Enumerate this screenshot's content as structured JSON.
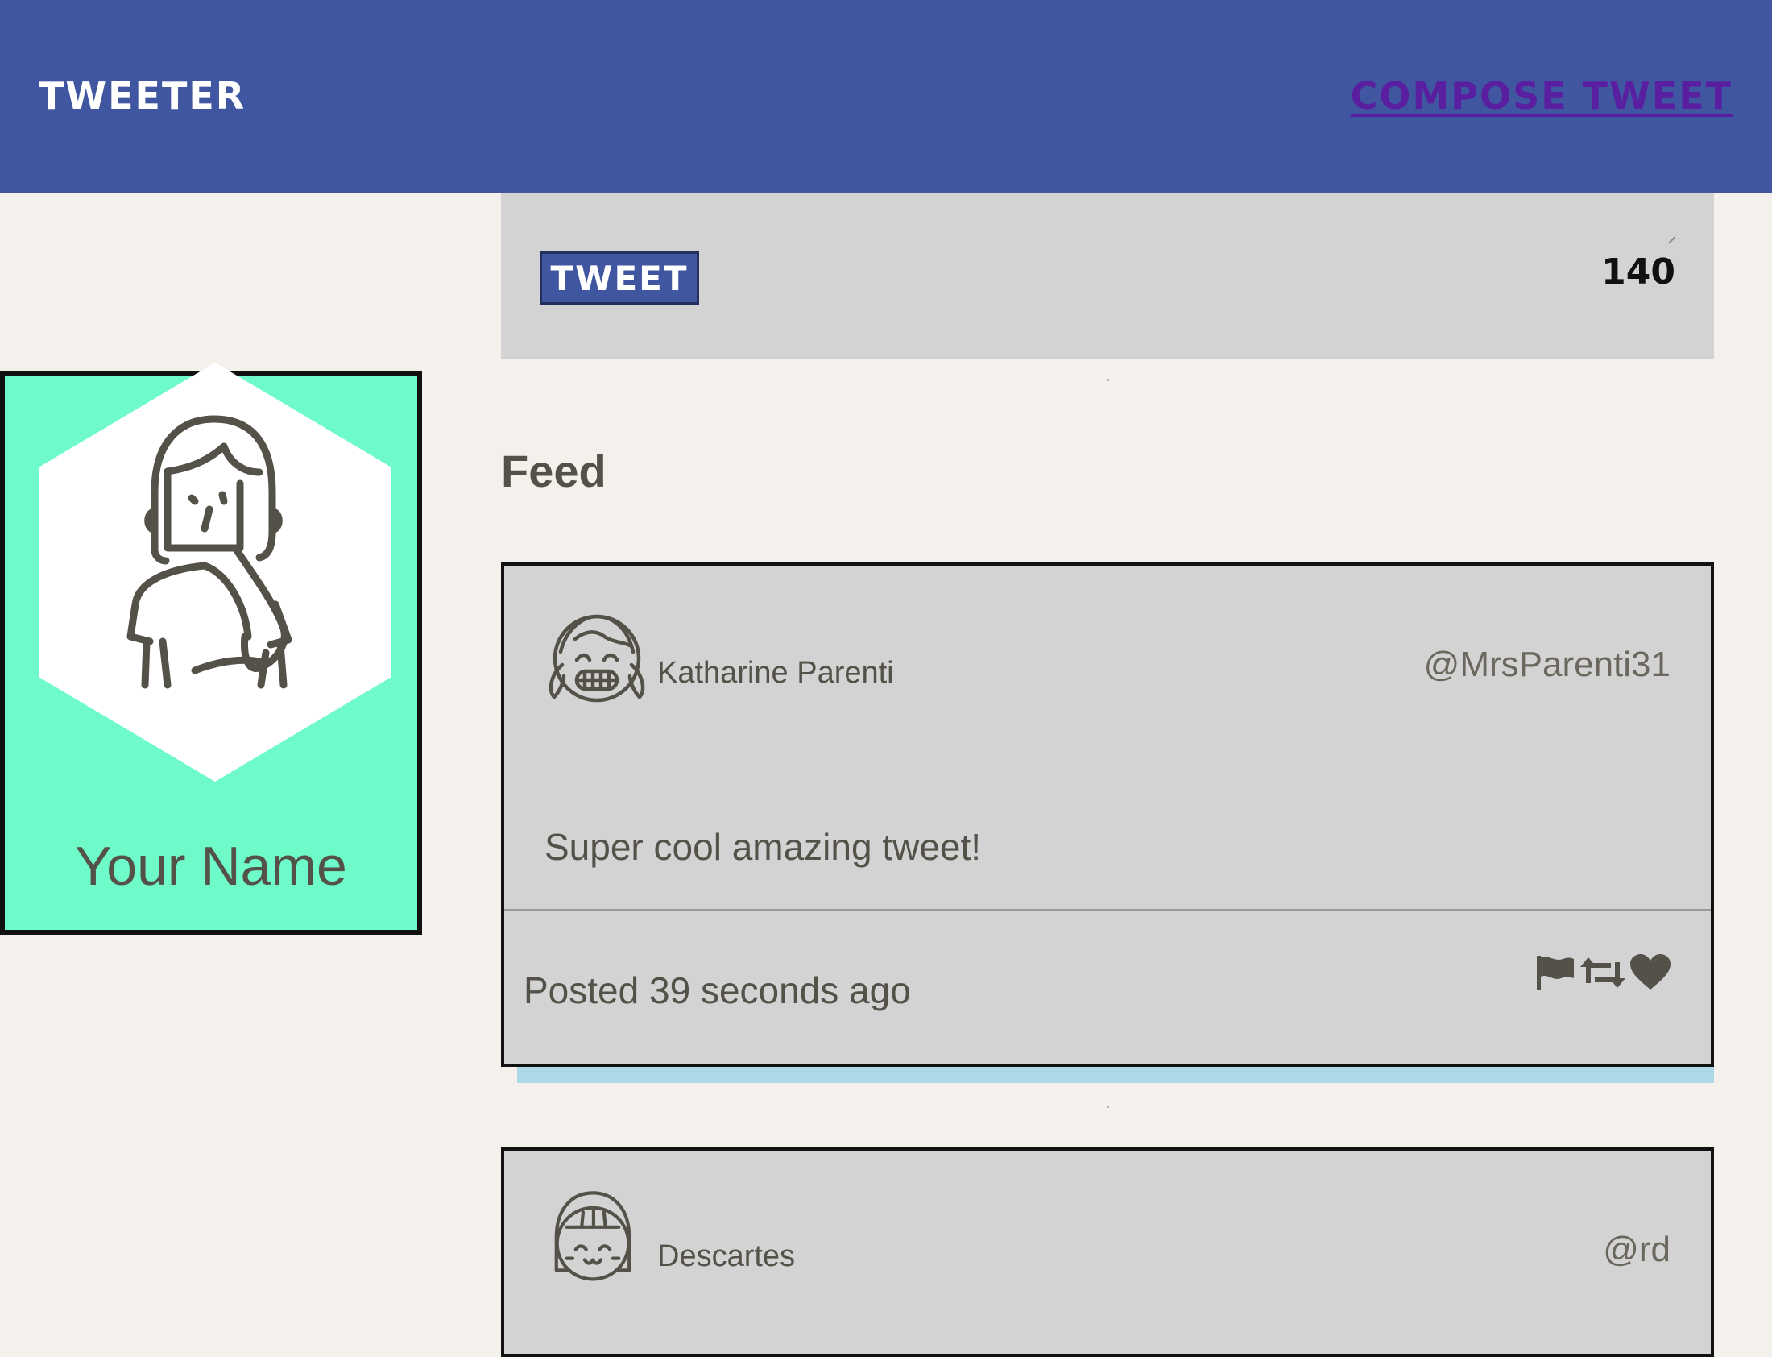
{
  "navbar": {
    "brand": "TWEETER",
    "compose_label": "COMPOSE TWEET"
  },
  "compose": {
    "button_label": "TWEET",
    "counter": "140"
  },
  "profile": {
    "name": "Your Name"
  },
  "feed": {
    "title": "Feed",
    "tweets": [
      {
        "author": "Katharine Parenti",
        "handle": "@MrsParenti31",
        "content": "Super cool amazing tweet!",
        "timestamp": "Posted 39 seconds ago"
      },
      {
        "author": "Descartes",
        "handle": "@rd"
      }
    ]
  },
  "colors": {
    "navbar": "#4056a1",
    "compose_link": "#5a1fa0",
    "profile_card": "#6ffbc9",
    "tweet_shadow": "#add8e6",
    "panel": "#d3d3d3",
    "page": "#f4f1ec"
  },
  "icons": {
    "flag": "flag-icon",
    "retweet": "retweet-icon",
    "like": "heart-icon"
  }
}
